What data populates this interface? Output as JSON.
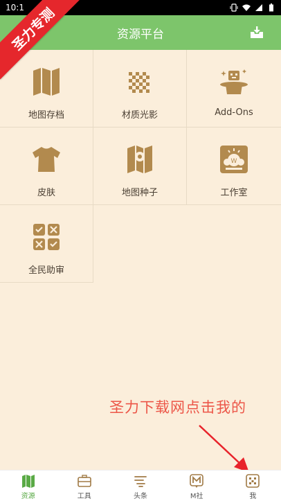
{
  "status_bar": {
    "time": "10:1"
  },
  "watermark": {
    "text": "圣力专测"
  },
  "header": {
    "title": "资源平台",
    "action_icon": "inbox-download-icon"
  },
  "grid": {
    "items": [
      {
        "label": "地图存档",
        "icon": "map-icon"
      },
      {
        "label": "材质光影",
        "icon": "checkerboard-icon"
      },
      {
        "label": "Add-Ons",
        "icon": "magic-hat-icon"
      },
      {
        "label": "皮肤",
        "icon": "tshirt-icon"
      },
      {
        "label": "地图种子",
        "icon": "map-pin-icon"
      },
      {
        "label": "工作室",
        "icon": "studio-icon"
      },
      {
        "label": "全民助审",
        "icon": "review-checklist-icon"
      }
    ]
  },
  "annotation": {
    "text": "圣力下载网点击我的"
  },
  "bottom_nav": {
    "items": [
      {
        "label": "资源",
        "icon": "map-icon",
        "active": true
      },
      {
        "label": "工具",
        "icon": "toolbox-icon",
        "active": false
      },
      {
        "label": "头条",
        "icon": "headline-icon",
        "active": false
      },
      {
        "label": "M社",
        "icon": "m-community-icon",
        "active": false
      },
      {
        "label": "我",
        "icon": "profile-icon",
        "active": false
      }
    ]
  },
  "colors": {
    "header_bg": "#7dc56b",
    "page_bg": "#fbeedb",
    "icon_brown": "#b28a4e",
    "annotation": "#ec5648",
    "active_nav": "#5aaa46"
  }
}
